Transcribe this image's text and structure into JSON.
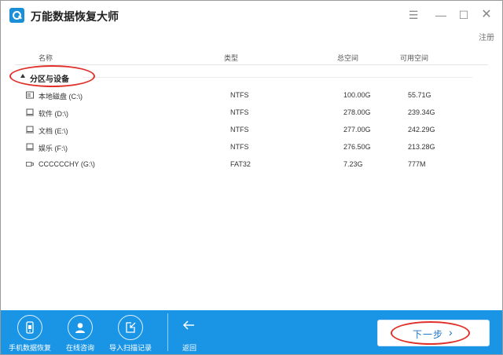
{
  "window": {
    "title": "万能数据恢复大师",
    "register": "注册"
  },
  "columns": {
    "name": "名称",
    "type": "类型",
    "total": "总空间",
    "free": "可用空间"
  },
  "group": {
    "label": "分区与设备"
  },
  "drives": [
    {
      "name": "本地磁盘 (C:\\)",
      "fs": "NTFS",
      "total": "100.00G",
      "free": "55.71G",
      "icon": "system-drive-icon"
    },
    {
      "name": "软件 (D:\\)",
      "fs": "NTFS",
      "total": "278.00G",
      "free": "239.34G",
      "icon": "hard-drive-icon"
    },
    {
      "name": "文档 (E:\\)",
      "fs": "NTFS",
      "total": "277.00G",
      "free": "242.29G",
      "icon": "hard-drive-icon"
    },
    {
      "name": "娱乐 (F:\\)",
      "fs": "NTFS",
      "total": "276.50G",
      "free": "213.28G",
      "icon": "hard-drive-icon"
    },
    {
      "name": "CCCCCCHY (G:\\)",
      "fs": "FAT32",
      "total": "7.23G",
      "free": "777M",
      "icon": "usb-drive-icon"
    }
  ],
  "bottom_bar": {
    "phone_recovery": "手机数据恢复",
    "online_consult": "在线咨询",
    "import_scan": "导入扫描记录",
    "back": "返回",
    "next": "下一步"
  },
  "colors": {
    "accent": "#1a95e6",
    "annotation": "#e0302a"
  }
}
